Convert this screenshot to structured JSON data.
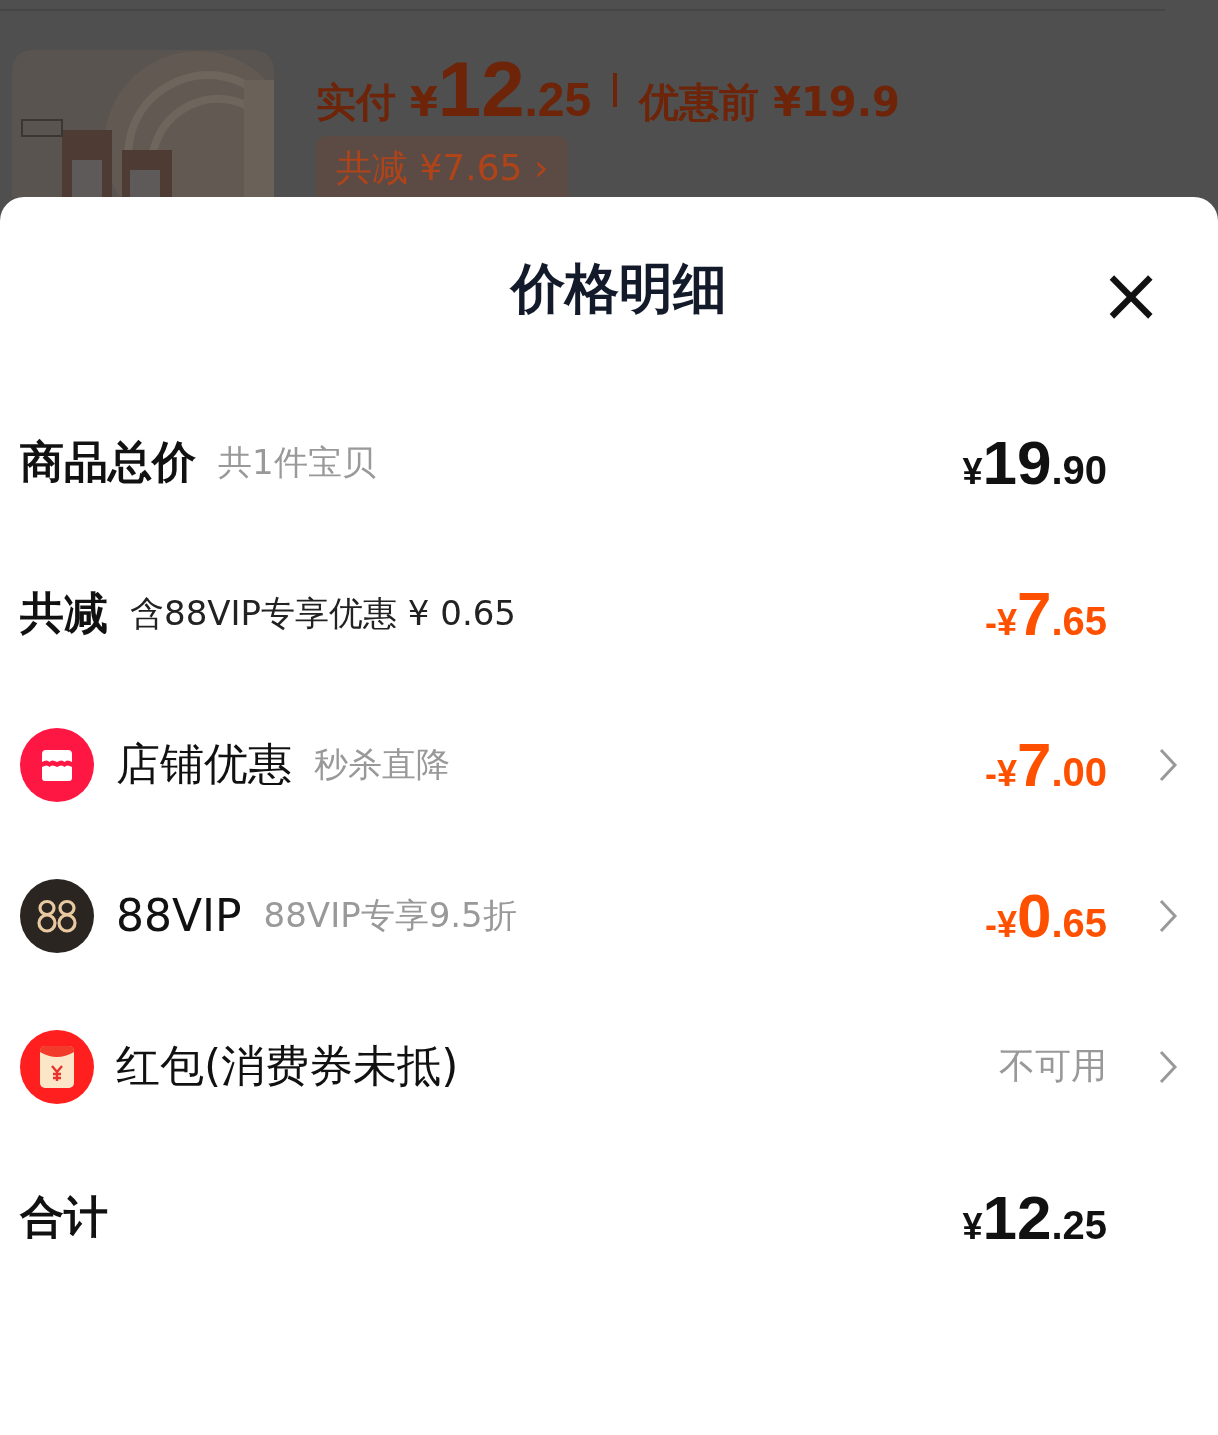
{
  "product": {
    "paid_label": "实付 ¥",
    "paid_int": "12",
    "paid_dec": ".25",
    "original_price": "优惠前 ¥19.9",
    "discount_pill": "共减 ¥7.65 ›"
  },
  "sheet": {
    "title": "价格明细",
    "close": "×",
    "rows": [
      {
        "kind": "total",
        "label": "商品总价",
        "note": "共1件宝贝",
        "amount": {
          "kind": "price",
          "prefix": "¥",
          "int": "19",
          "dec": ".90",
          "discount": false
        },
        "chevron": false
      },
      {
        "kind": "savings",
        "label": "共减",
        "note": "含88VIP专享优惠 ¥ 0.65",
        "amount": {
          "kind": "price",
          "prefix": "-¥",
          "int": "7",
          "dec": ".65",
          "discount": true
        },
        "chevron": false
      },
      {
        "kind": "shop",
        "label": "店铺优惠",
        "note": "秒杀直降",
        "amount": {
          "kind": "price",
          "prefix": "-¥",
          "int": "7",
          "dec": ".00",
          "discount": true
        },
        "chevron": true
      },
      {
        "kind": "vip",
        "label": "88VIP",
        "note": "88VIP专享9.5折",
        "amount": {
          "kind": "price",
          "prefix": "-¥",
          "int": "0",
          "dec": ".65",
          "discount": true
        },
        "chevron": true
      },
      {
        "kind": "envelope",
        "label": "红包(消费券未抵)",
        "amount": {
          "kind": "text",
          "text": "不可用"
        },
        "chevron": true
      },
      {
        "kind": "total",
        "label": "合计",
        "amount": {
          "kind": "price",
          "prefix": "¥",
          "int": "12",
          "dec": ".25",
          "discount": false
        },
        "chevron": false
      }
    ]
  }
}
